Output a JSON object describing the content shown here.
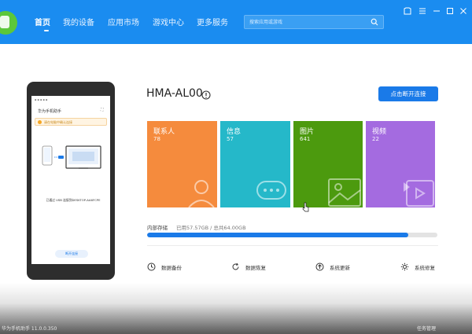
{
  "nav": {
    "items": [
      {
        "label": "首页",
        "active": true
      },
      {
        "label": "我的设备"
      },
      {
        "label": "应用市场"
      },
      {
        "label": "游戏中心"
      },
      {
        "label": "更多服务"
      }
    ],
    "search_placeholder": "搜索应用或游戏",
    "window_controls": [
      "skin-icon",
      "menu-icon",
      "minimize-icon",
      "maximize-icon",
      "close-icon"
    ]
  },
  "phone": {
    "app_title": "华为手机助手",
    "notice": "请在电脑中确认连接",
    "description": "已通过 USB 连接到DESKTOP-AA6FCPE",
    "button": "断开连接"
  },
  "device": {
    "name": "HMA-AL00",
    "disconnect_label": "点击断开连接"
  },
  "tiles": [
    {
      "label": "联系人",
      "count": "78",
      "color": "#f58b3d",
      "icon": "person-icon"
    },
    {
      "label": "信息",
      "count": "57",
      "color": "#25b8c9",
      "icon": "chat-icon"
    },
    {
      "label": "图片",
      "count": "641",
      "color": "#4c9a0e",
      "icon": "picture-icon"
    },
    {
      "label": "视频",
      "count": "22",
      "color": "#a46be0",
      "icon": "video-icon"
    }
  ],
  "storage": {
    "label": "内部存储",
    "value": "已用57.57GB / 总共64.00GB",
    "used_fraction": 0.9
  },
  "actions": [
    {
      "label": "数据备份",
      "icon": "backup-clock-icon"
    },
    {
      "label": "数据恢复",
      "icon": "restore-icon"
    },
    {
      "label": "系统更新",
      "icon": "update-arrow-icon"
    },
    {
      "label": "系统修复",
      "icon": "repair-gear-icon"
    }
  ],
  "footer": {
    "version": "华为手机助手 11.0.0.350",
    "task_manager": "任务管理"
  },
  "colors": {
    "accent": "#1a8cf0",
    "button": "#1a7ae8",
    "logo": "#5cc73a"
  }
}
